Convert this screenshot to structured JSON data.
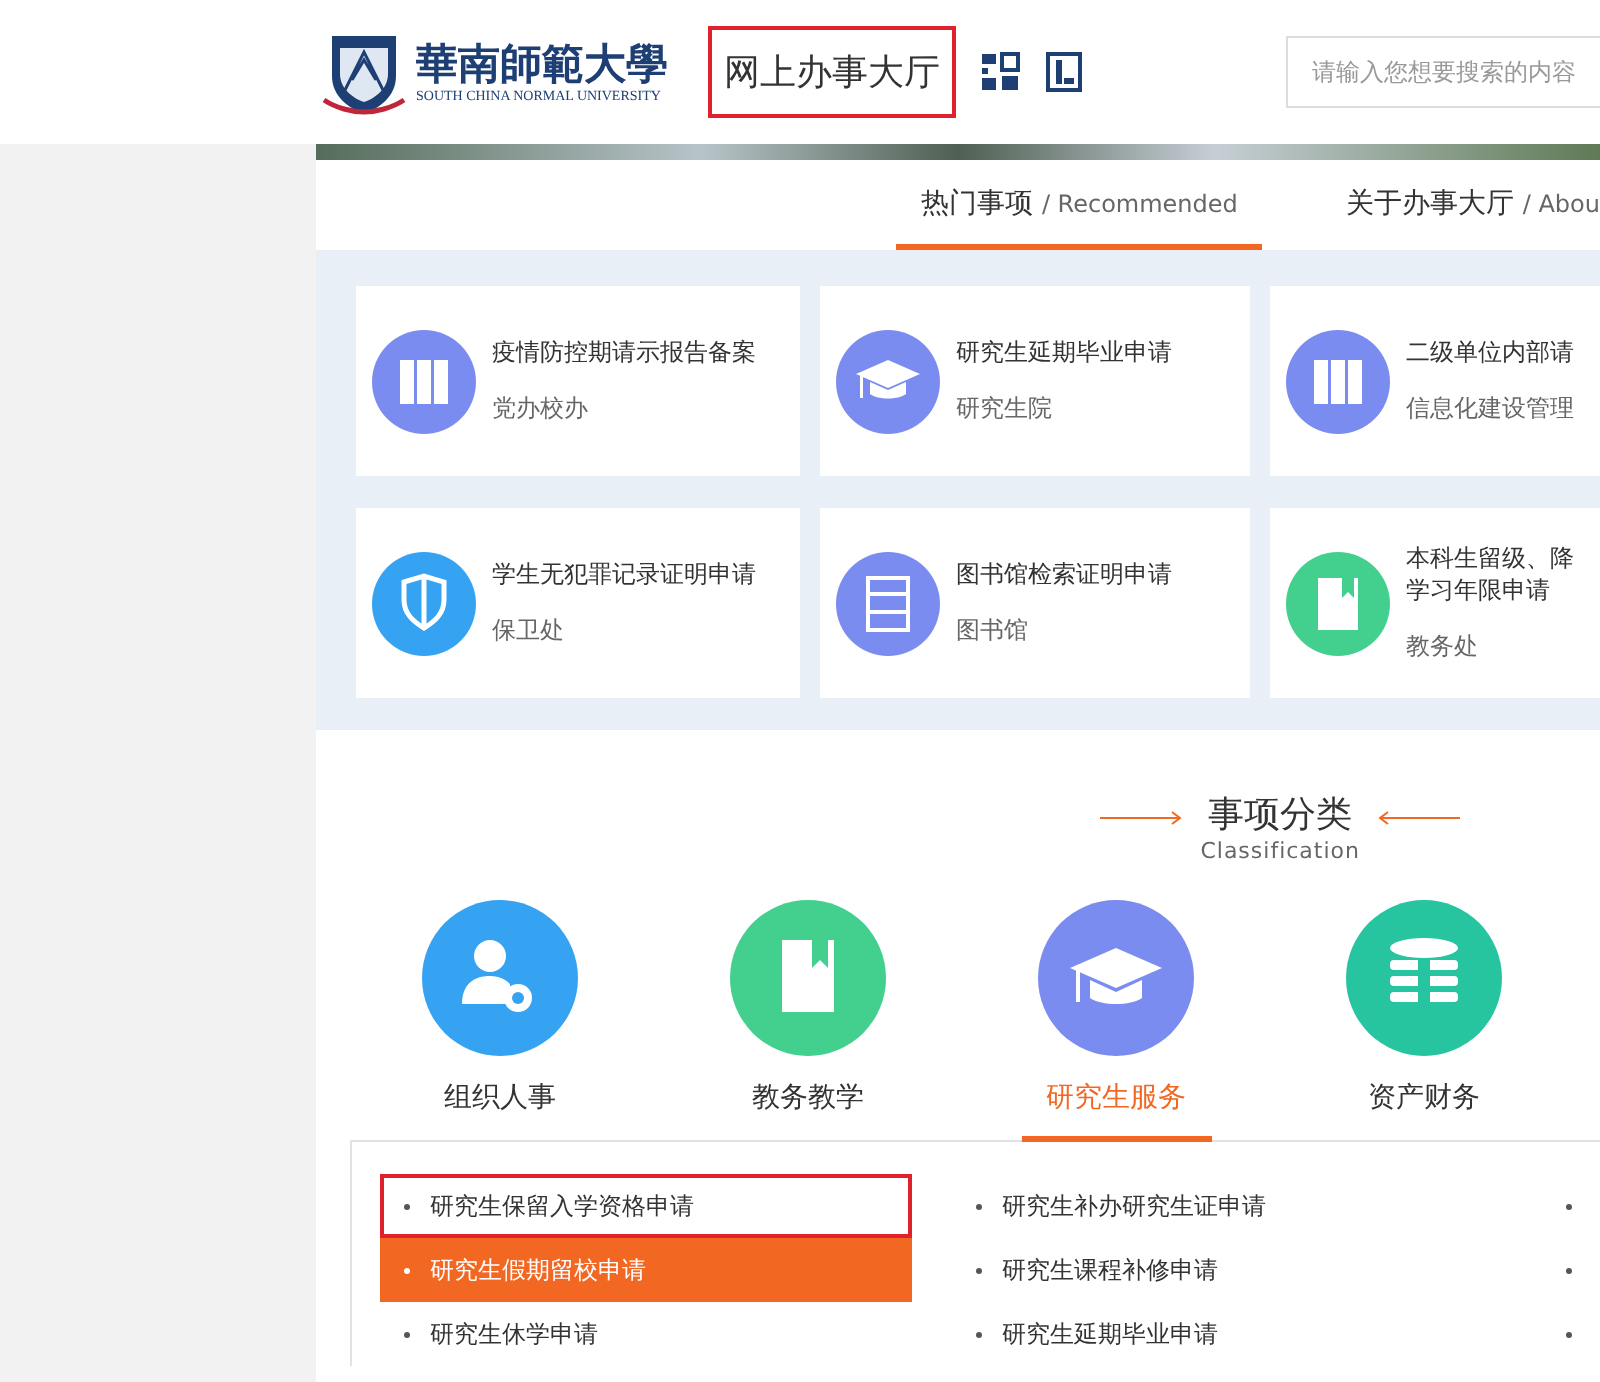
{
  "header": {
    "logo_name": "華南師範大學",
    "logo_subtitle": "SOUTH CHINA NORMAL UNIVERSITY",
    "title": "网上办事大厅",
    "title_highlighted": true,
    "search": {
      "placeholder": "请输入您想要搜索的内容"
    }
  },
  "tabs": [
    {
      "label": "热门事项",
      "sub": "/ Recommended",
      "selected": true
    },
    {
      "label": "关于办事大厅",
      "sub": "/ Abou",
      "selected": false
    }
  ],
  "hot_items": [
    {
      "title": "疫情防控期请示报告备案",
      "dept": "党办校办",
      "kind": "binders",
      "color": "#7b8cf0"
    },
    {
      "title": "研究生延期毕业申请",
      "dept": "研究生院",
      "kind": "cap",
      "color": "#7b8cf0"
    },
    {
      "title": "二级单位内部请",
      "dept": "信息化建设管理",
      "kind": "binders",
      "color": "#7b8cf0"
    },
    {
      "title": "学生无犯罪记录证明申请",
      "dept": "保卫处",
      "kind": "shield",
      "color": "#36a3f2"
    },
    {
      "title": "图书馆检索证明申请",
      "dept": "图书馆",
      "kind": "shelf",
      "color": "#7b8cf0"
    },
    {
      "title": "本科生留级、降学习年限申请",
      "dept": "教务处",
      "kind": "book",
      "color": "#43cf8e"
    }
  ],
  "classification": {
    "title": "事项分类",
    "subtitle": "Classification",
    "categories": [
      {
        "label": "组织人事",
        "kind": "person",
        "color": "#36a3f2",
        "selected": false
      },
      {
        "label": "教务教学",
        "kind": "book",
        "color": "#43cf8e",
        "selected": false
      },
      {
        "label": "研究生服务",
        "kind": "cap",
        "color": "#7b8cf0",
        "selected": true
      },
      {
        "label": "资产财务",
        "kind": "coins",
        "color": "#27c4a0",
        "selected": false
      }
    ],
    "columns": [
      [
        {
          "text": "研究生保留入学资格申请",
          "selected": false,
          "highlighted": true
        },
        {
          "text": "研究生假期留校申请",
          "selected": true,
          "highlighted": false
        },
        {
          "text": "研究生休学申请",
          "selected": false,
          "highlighted": false
        }
      ],
      [
        {
          "text": "研究生补办研究生证申请",
          "selected": false,
          "highlighted": false
        },
        {
          "text": "研究生课程补修申请",
          "selected": false,
          "highlighted": false
        },
        {
          "text": "研究生延期毕业申请",
          "selected": false,
          "highlighted": false
        }
      ],
      [
        {
          "selected": false,
          "highlighted": false
        },
        {
          "selected": false,
          "highlighted": false
        },
        {
          "selected": false,
          "highlighted": false
        }
      ]
    ]
  }
}
